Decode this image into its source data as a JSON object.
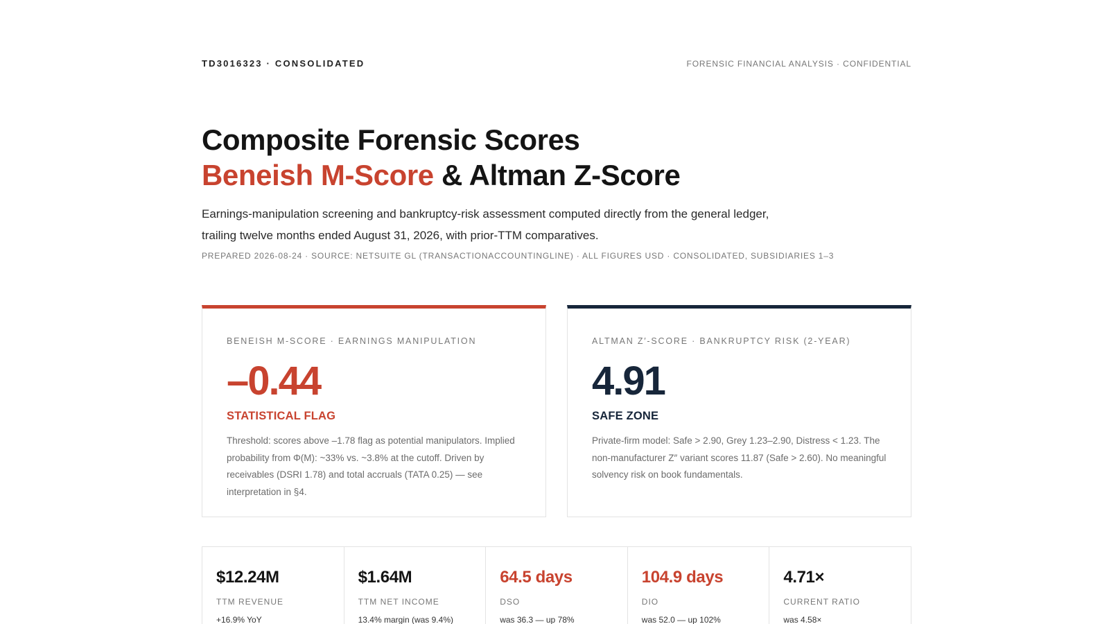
{
  "header": {
    "left": "TD3016323 · CONSOLIDATED",
    "right": "FORENSIC FINANCIAL ANALYSIS · CONFIDENTIAL"
  },
  "title": {
    "line1": "Composite Forensic Scores",
    "accent": "Beneish M-Score",
    "rest": " & Altman Z-Score"
  },
  "lede": "Earnings-manipulation screening and bankruptcy-risk assessment computed directly from the general ledger, trailing twelve months ended August 31, 2026, with prior-TTM comparatives.",
  "meta": "PREPARED 2026-08-24 · SOURCE: NETSUITE GL (TRANSACTIONACCOUNTINGLINE) · ALL FIGURES USD · CONSOLIDATED, SUBSIDIARIES 1–3",
  "cards": {
    "beneish": {
      "label": "BENEISH M-SCORE · EARNINGS MANIPULATION",
      "score": "–0.44",
      "verdict": "STATISTICAL FLAG",
      "desc": "Threshold: scores above –1.78 flag as potential manipulators. Implied probability from Φ(M): ~33% vs. ~3.8% at the cutoff. Driven by receivables (DSRI 1.78) and total accruals (TATA 0.25) — see interpretation in §4."
    },
    "altman": {
      "label": "ALTMAN Z′-SCORE · BANKRUPTCY RISK (2-YEAR)",
      "score": "4.91",
      "verdict": "SAFE ZONE",
      "desc": "Private-firm model: Safe > 2.90, Grey 1.23–2.90, Distress < 1.23. The non-manufacturer Z″ variant scores 11.87 (Safe > 2.60). No meaningful solvency risk on book fundamentals."
    }
  },
  "kpis": [
    {
      "value": "$12.24M",
      "name": "TTM REVENUE",
      "sub": "+16.9% YoY"
    },
    {
      "value": "$1.64M",
      "name": "TTM NET INCOME",
      "sub": "13.4% margin (was 9.4%)"
    },
    {
      "value": "64.5 days",
      "name": "DSO",
      "sub": "was 36.3 — up 78%"
    },
    {
      "value": "104.9 days",
      "name": "DIO",
      "sub": "was 52.0 — up 102%"
    },
    {
      "value": "4.71×",
      "name": "CURRENT RATIO",
      "sub": "was 4.58×"
    }
  ],
  "colors": {
    "accent": "#c8432f",
    "navy": "#17263a"
  }
}
